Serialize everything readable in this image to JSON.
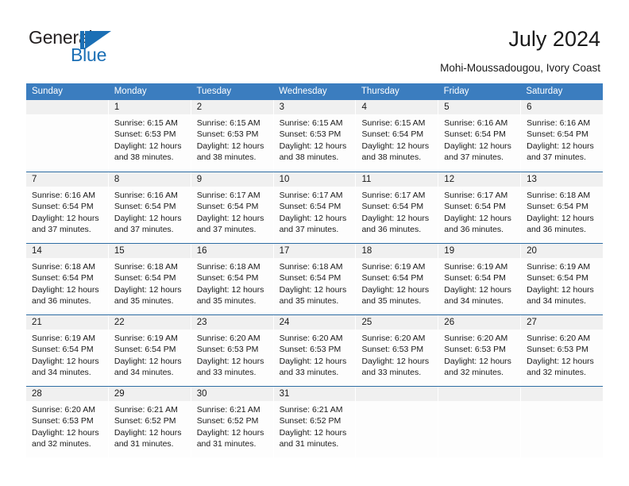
{
  "brand": {
    "name_dark": "General",
    "name_blue": "Blue",
    "accent_color": "#1b6fb5"
  },
  "header": {
    "title": "July 2024",
    "subtitle": "Mohi-Moussadougou, Ivory Coast"
  },
  "calendar": {
    "header_bg": "#3b7dbf",
    "header_text_color": "#ffffff",
    "daynum_band_bg": "#f0f0f0",
    "row_divider_color": "#2e6da4",
    "weekdays": [
      "Sunday",
      "Monday",
      "Tuesday",
      "Wednesday",
      "Thursday",
      "Friday",
      "Saturday"
    ],
    "weeks": [
      [
        {
          "day": "",
          "lines": []
        },
        {
          "day": "1",
          "lines": [
            "Sunrise: 6:15 AM",
            "Sunset: 6:53 PM",
            "Daylight: 12 hours",
            "and 38 minutes."
          ]
        },
        {
          "day": "2",
          "lines": [
            "Sunrise: 6:15 AM",
            "Sunset: 6:53 PM",
            "Daylight: 12 hours",
            "and 38 minutes."
          ]
        },
        {
          "day": "3",
          "lines": [
            "Sunrise: 6:15 AM",
            "Sunset: 6:53 PM",
            "Daylight: 12 hours",
            "and 38 minutes."
          ]
        },
        {
          "day": "4",
          "lines": [
            "Sunrise: 6:15 AM",
            "Sunset: 6:54 PM",
            "Daylight: 12 hours",
            "and 38 minutes."
          ]
        },
        {
          "day": "5",
          "lines": [
            "Sunrise: 6:16 AM",
            "Sunset: 6:54 PM",
            "Daylight: 12 hours",
            "and 37 minutes."
          ]
        },
        {
          "day": "6",
          "lines": [
            "Sunrise: 6:16 AM",
            "Sunset: 6:54 PM",
            "Daylight: 12 hours",
            "and 37 minutes."
          ]
        }
      ],
      [
        {
          "day": "7",
          "lines": [
            "Sunrise: 6:16 AM",
            "Sunset: 6:54 PM",
            "Daylight: 12 hours",
            "and 37 minutes."
          ]
        },
        {
          "day": "8",
          "lines": [
            "Sunrise: 6:16 AM",
            "Sunset: 6:54 PM",
            "Daylight: 12 hours",
            "and 37 minutes."
          ]
        },
        {
          "day": "9",
          "lines": [
            "Sunrise: 6:17 AM",
            "Sunset: 6:54 PM",
            "Daylight: 12 hours",
            "and 37 minutes."
          ]
        },
        {
          "day": "10",
          "lines": [
            "Sunrise: 6:17 AM",
            "Sunset: 6:54 PM",
            "Daylight: 12 hours",
            "and 37 minutes."
          ]
        },
        {
          "day": "11",
          "lines": [
            "Sunrise: 6:17 AM",
            "Sunset: 6:54 PM",
            "Daylight: 12 hours",
            "and 36 minutes."
          ]
        },
        {
          "day": "12",
          "lines": [
            "Sunrise: 6:17 AM",
            "Sunset: 6:54 PM",
            "Daylight: 12 hours",
            "and 36 minutes."
          ]
        },
        {
          "day": "13",
          "lines": [
            "Sunrise: 6:18 AM",
            "Sunset: 6:54 PM",
            "Daylight: 12 hours",
            "and 36 minutes."
          ]
        }
      ],
      [
        {
          "day": "14",
          "lines": [
            "Sunrise: 6:18 AM",
            "Sunset: 6:54 PM",
            "Daylight: 12 hours",
            "and 36 minutes."
          ]
        },
        {
          "day": "15",
          "lines": [
            "Sunrise: 6:18 AM",
            "Sunset: 6:54 PM",
            "Daylight: 12 hours",
            "and 35 minutes."
          ]
        },
        {
          "day": "16",
          "lines": [
            "Sunrise: 6:18 AM",
            "Sunset: 6:54 PM",
            "Daylight: 12 hours",
            "and 35 minutes."
          ]
        },
        {
          "day": "17",
          "lines": [
            "Sunrise: 6:18 AM",
            "Sunset: 6:54 PM",
            "Daylight: 12 hours",
            "and 35 minutes."
          ]
        },
        {
          "day": "18",
          "lines": [
            "Sunrise: 6:19 AM",
            "Sunset: 6:54 PM",
            "Daylight: 12 hours",
            "and 35 minutes."
          ]
        },
        {
          "day": "19",
          "lines": [
            "Sunrise: 6:19 AM",
            "Sunset: 6:54 PM",
            "Daylight: 12 hours",
            "and 34 minutes."
          ]
        },
        {
          "day": "20",
          "lines": [
            "Sunrise: 6:19 AM",
            "Sunset: 6:54 PM",
            "Daylight: 12 hours",
            "and 34 minutes."
          ]
        }
      ],
      [
        {
          "day": "21",
          "lines": [
            "Sunrise: 6:19 AM",
            "Sunset: 6:54 PM",
            "Daylight: 12 hours",
            "and 34 minutes."
          ]
        },
        {
          "day": "22",
          "lines": [
            "Sunrise: 6:19 AM",
            "Sunset: 6:54 PM",
            "Daylight: 12 hours",
            "and 34 minutes."
          ]
        },
        {
          "day": "23",
          "lines": [
            "Sunrise: 6:20 AM",
            "Sunset: 6:53 PM",
            "Daylight: 12 hours",
            "and 33 minutes."
          ]
        },
        {
          "day": "24",
          "lines": [
            "Sunrise: 6:20 AM",
            "Sunset: 6:53 PM",
            "Daylight: 12 hours",
            "and 33 minutes."
          ]
        },
        {
          "day": "25",
          "lines": [
            "Sunrise: 6:20 AM",
            "Sunset: 6:53 PM",
            "Daylight: 12 hours",
            "and 33 minutes."
          ]
        },
        {
          "day": "26",
          "lines": [
            "Sunrise: 6:20 AM",
            "Sunset: 6:53 PM",
            "Daylight: 12 hours",
            "and 32 minutes."
          ]
        },
        {
          "day": "27",
          "lines": [
            "Sunrise: 6:20 AM",
            "Sunset: 6:53 PM",
            "Daylight: 12 hours",
            "and 32 minutes."
          ]
        }
      ],
      [
        {
          "day": "28",
          "lines": [
            "Sunrise: 6:20 AM",
            "Sunset: 6:53 PM",
            "Daylight: 12 hours",
            "and 32 minutes."
          ]
        },
        {
          "day": "29",
          "lines": [
            "Sunrise: 6:21 AM",
            "Sunset: 6:52 PM",
            "Daylight: 12 hours",
            "and 31 minutes."
          ]
        },
        {
          "day": "30",
          "lines": [
            "Sunrise: 6:21 AM",
            "Sunset: 6:52 PM",
            "Daylight: 12 hours",
            "and 31 minutes."
          ]
        },
        {
          "day": "31",
          "lines": [
            "Sunrise: 6:21 AM",
            "Sunset: 6:52 PM",
            "Daylight: 12 hours",
            "and 31 minutes."
          ]
        },
        {
          "day": "",
          "lines": []
        },
        {
          "day": "",
          "lines": []
        },
        {
          "day": "",
          "lines": []
        }
      ]
    ]
  }
}
